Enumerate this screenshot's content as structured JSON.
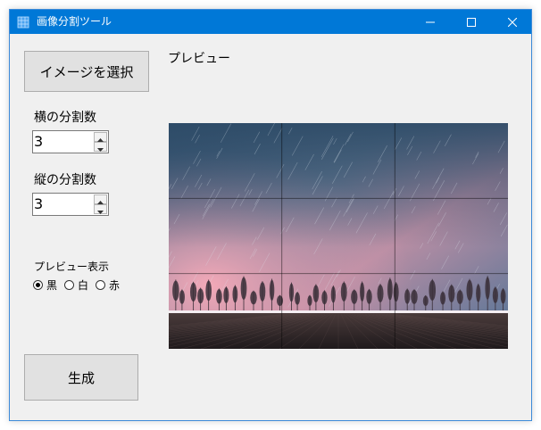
{
  "window": {
    "title": "画像分割ツール",
    "accent_color": "#0078d7",
    "controls": {
      "minimize_icon": "minimize-icon",
      "maximize_icon": "maximize-icon",
      "close_icon": "close-icon"
    }
  },
  "main": {
    "select_image_label": "イメージを選択",
    "preview_label": "プレビュー",
    "horizontal_divisions": {
      "label": "横の分割数",
      "value": "3"
    },
    "vertical_divisions": {
      "label": "縦の分割数",
      "value": "3"
    },
    "preview_display": {
      "label": "プレビュー表示",
      "options": [
        {
          "label": "黒",
          "checked": true
        },
        {
          "label": "白",
          "checked": false
        },
        {
          "label": "赤",
          "checked": false
        }
      ]
    },
    "generate_label": "生成"
  },
  "preview": {
    "grid_rows": 3,
    "grid_cols": 3,
    "grid_line_color": "#000000"
  }
}
